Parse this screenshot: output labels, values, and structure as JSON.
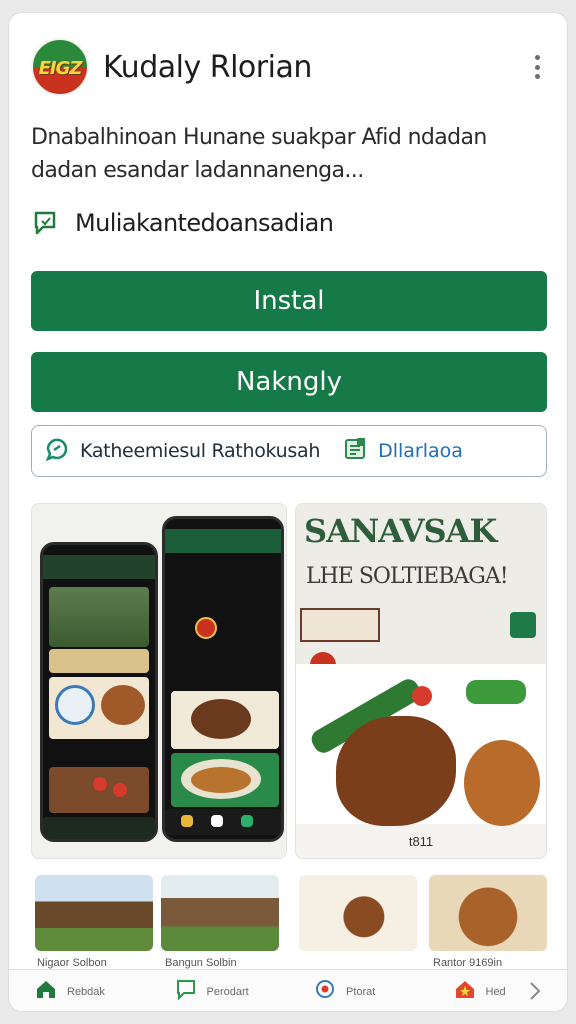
{
  "app": {
    "logo_text": "EIGZ",
    "title": "Kudaly Rlorian"
  },
  "description": "Dnabalhinoan Hunane suakpar Afid ndadan dadan esandar ladannanenga...",
  "feature": {
    "label": "Muliakantedoansadian",
    "icon": "chat-square-icon"
  },
  "buttons": {
    "install": "Instal",
    "secondary": "Nakngly"
  },
  "infobar": {
    "left_text": "Katheemiesul Rathokusah",
    "right_text": "Dllarlaoa",
    "left_icon": "link-chat-icon",
    "right_icon": "document-icon"
  },
  "screenshots": {
    "right": {
      "title": "SANAVSAK",
      "subtitle": "LHE SOLTIEBAGA!",
      "label": "t811"
    }
  },
  "thumbnails": [
    {
      "caption": "Nigaor Solbon"
    },
    {
      "caption": "Bangun Solbin"
    },
    {
      "caption": "Rantor 9169in"
    }
  ],
  "nav": [
    {
      "label": "Rebdak",
      "icon": "home-icon"
    },
    {
      "label": "Perodart",
      "icon": "chat-icon"
    },
    {
      "label": "Ptorat",
      "icon": "target-icon"
    },
    {
      "label": "Hed",
      "icon": "house-star-icon"
    }
  ],
  "colors": {
    "primary": "#157a47",
    "link": "#1e6fb8",
    "logo_top": "#2a8a3a",
    "logo_bottom": "#c9321f"
  }
}
